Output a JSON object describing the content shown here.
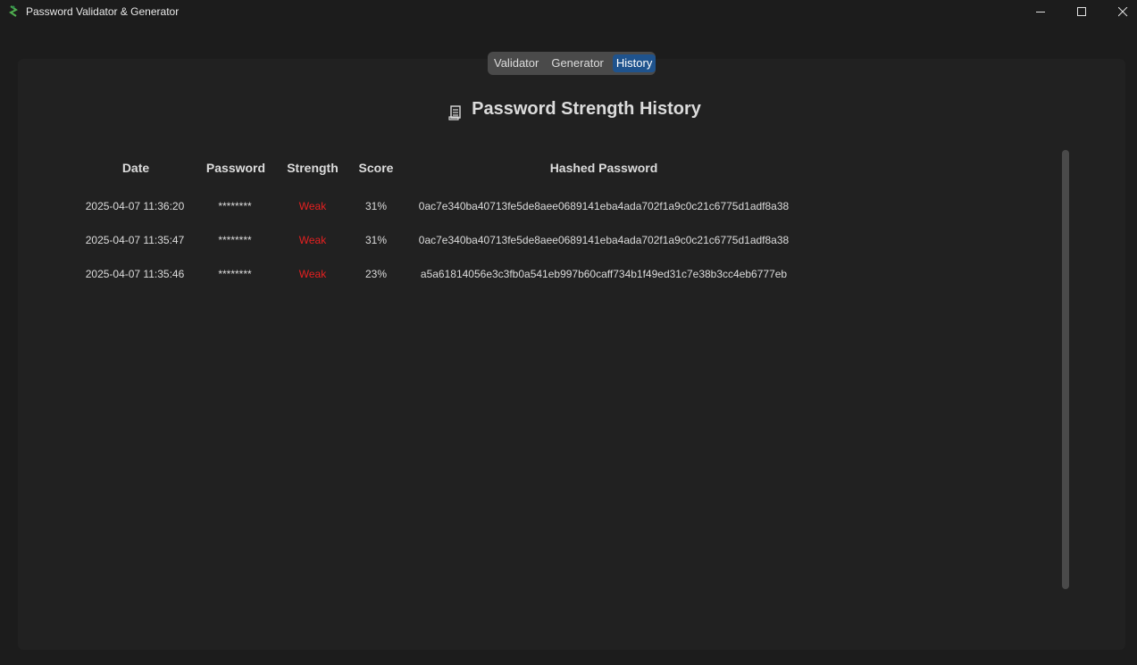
{
  "window": {
    "title": "Password Validator & Generator"
  },
  "tabs": [
    {
      "label": "Validator",
      "active": false
    },
    {
      "label": "Generator",
      "active": false
    },
    {
      "label": "History",
      "active": true
    }
  ],
  "page": {
    "title": "Password Strength History",
    "title_icon": "scroll-icon"
  },
  "table": {
    "columns": [
      "Date",
      "Password",
      "Strength",
      "Score",
      "Hashed Password"
    ],
    "rows": [
      {
        "date": "2025-04-07 11:36:20",
        "password": "********",
        "strength": "Weak",
        "score": "31%",
        "hash": "0ac7e340ba40713fe5de8aee0689141eba4ada702f1a9c0c21c6775d1adf8a38"
      },
      {
        "date": "2025-04-07 11:35:47",
        "password": "********",
        "strength": "Weak",
        "score": "31%",
        "hash": "0ac7e340ba40713fe5de8aee0689141eba4ada702f1a9c0c21c6775d1adf8a38"
      },
      {
        "date": "2025-04-07 11:35:46",
        "password": "********",
        "strength": "Weak",
        "score": "23%",
        "hash": "a5a61814056e3c3fb0a541eb997b60caff734b1f49ed31c7e38b3cc4eb6777eb"
      }
    ]
  },
  "colors": {
    "weak": "#e62020",
    "accent": "#1f538d",
    "panel": "#212121",
    "background": "#1c1c1c"
  }
}
